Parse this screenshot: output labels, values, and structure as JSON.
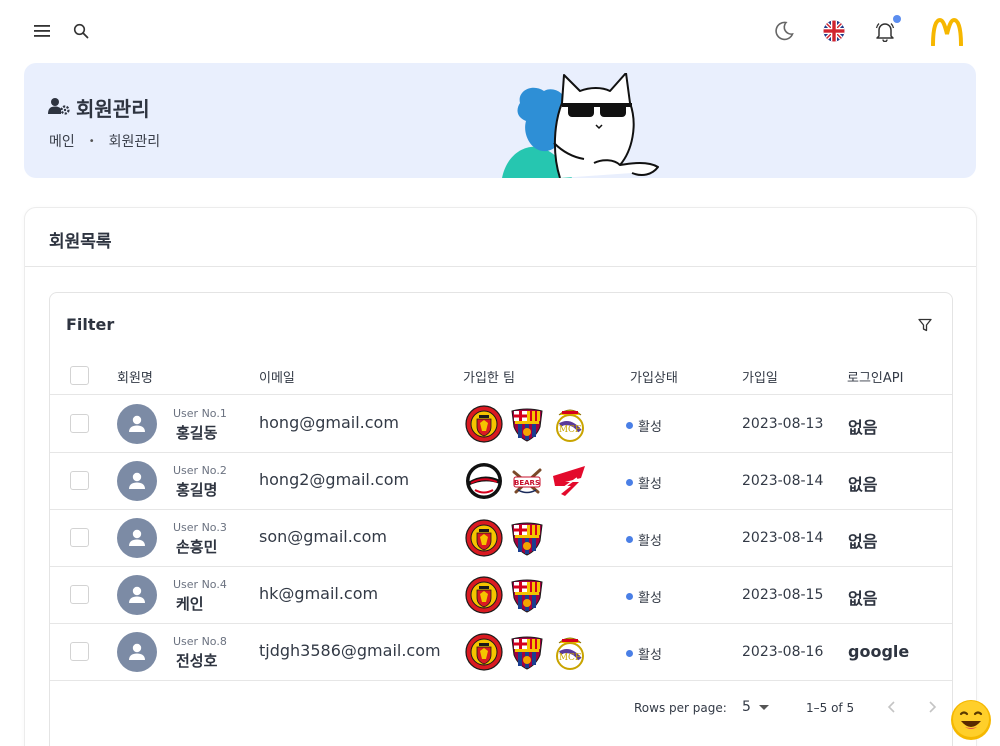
{
  "topbar": {
    "menu_icon": "hamburger-menu-icon",
    "search_icon": "search-icon",
    "theme_icon": "moon-icon",
    "language_icon": "uk-flag-icon",
    "notification_icon": "bell-icon",
    "brand_icon": "golden-arches-logo"
  },
  "hero": {
    "title": "회원관리",
    "title_icon": "user-gear-icon",
    "breadcrumb": [
      "메인",
      "회원관리"
    ],
    "breadcrumb_separator": "•"
  },
  "card": {
    "title": "회원목록",
    "filter_title": "Filter",
    "filter_icon": "filter-icon"
  },
  "table": {
    "columns": [
      "회원명",
      "이메일",
      "가입한 팀",
      "가입상태",
      "가입일",
      "로그인API"
    ],
    "rows": [
      {
        "user_no": "User No.1",
        "name": "홍길동",
        "email": "hong@gmail.com",
        "teams": [
          "manchester-united-crest",
          "fc-barcelona-crest",
          "real-madrid-crest"
        ],
        "status": "활성",
        "date": "2023-08-13",
        "api": "없음"
      },
      {
        "user_no": "User No.2",
        "name": "홍길명",
        "email": "hong2@gmail.com",
        "teams": [
          "baseball-team-a-logo",
          "baseball-team-b-logo",
          "baseball-team-c-logo"
        ],
        "status": "활성",
        "date": "2023-08-14",
        "api": "없음"
      },
      {
        "user_no": "User No.3",
        "name": "손흥민",
        "email": "son@gmail.com",
        "teams": [
          "manchester-united-crest",
          "fc-barcelona-crest"
        ],
        "status": "활성",
        "date": "2023-08-14",
        "api": "없음"
      },
      {
        "user_no": "User No.4",
        "name": "케인",
        "email": "hk@gmail.com",
        "teams": [
          "manchester-united-crest",
          "fc-barcelona-crest"
        ],
        "status": "활성",
        "date": "2023-08-15",
        "api": "없음"
      },
      {
        "user_no": "User No.8",
        "name": "전성호",
        "email": "tjdgh3586@gmail.com",
        "teams": [
          "manchester-united-crest",
          "fc-barcelona-crest",
          "real-madrid-crest"
        ],
        "status": "활성",
        "date": "2023-08-16",
        "api": "google"
      }
    ]
  },
  "pagination": {
    "rows_per_page_label": "Rows per page:",
    "rows_per_page_value": "5",
    "range": "1–5 of 5"
  },
  "colors": {
    "hero_bg": "#e9effd",
    "status_active": "#4a7fe6",
    "avatar_bg": "#7c8ba5"
  }
}
